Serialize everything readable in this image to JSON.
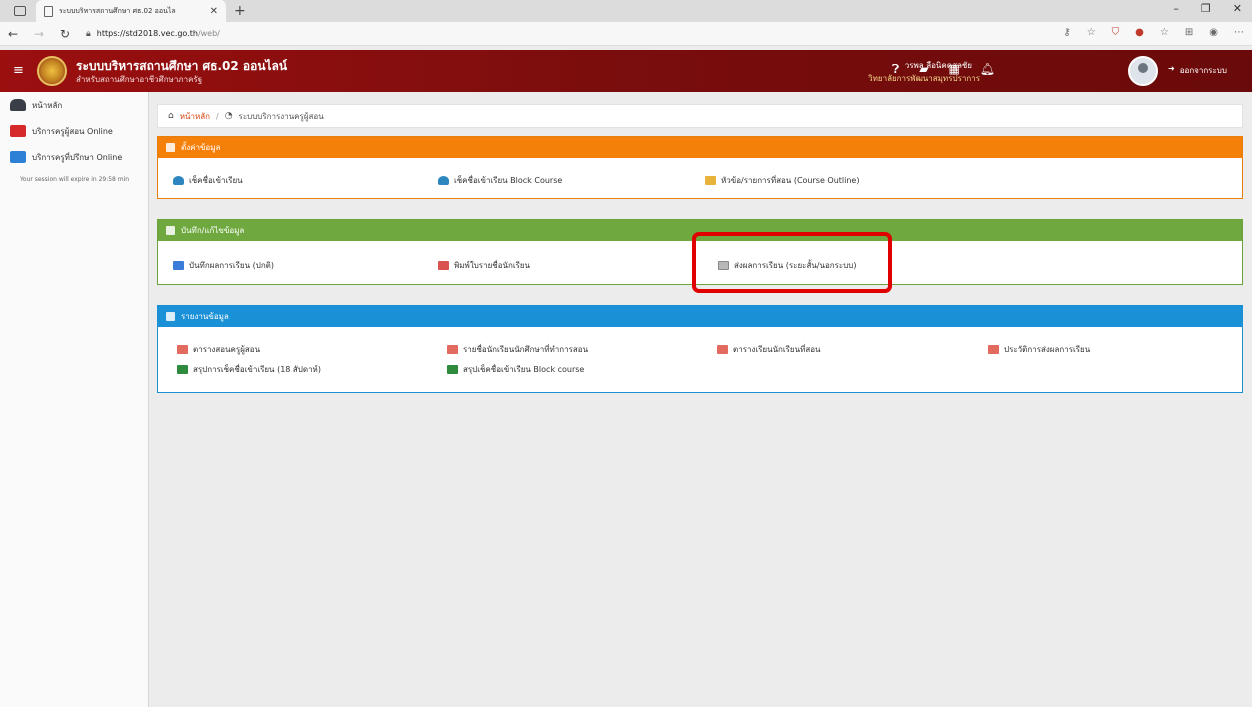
{
  "browser": {
    "tab_title": "ระบบบริหารสถานศึกษา ศธ.02 ออนไล",
    "url_host": "https://std2018.vec.go.th",
    "url_path": "/web/"
  },
  "header": {
    "title": "ระบบบริหารสถานศึกษา ศธ.02 ออนไลน์",
    "subtitle": "สำหรับสถานศึกษาอาชีวศึกษาภาครัฐ",
    "user_name": "วรพล ลือนิคคสุลชัย",
    "user_org": "วิทยาลัยการพัฒนาสมุทรปราการ",
    "logout_label": "ออกจากระบบ"
  },
  "sidebar": {
    "items": [
      {
        "label": "หน้าหลัก"
      },
      {
        "label": "บริการครูผู้สอน Online"
      },
      {
        "label": "บริการครูที่ปรึกษา Online"
      }
    ],
    "session_note": "Your session will expire in 29:58 min"
  },
  "breadcrumb": {
    "home": "หน้าหลัก",
    "separator": "/",
    "current": "ระบบบริการงานครูผู้สอน"
  },
  "panels": {
    "settings": {
      "title": "ตั้งค่าข้อมูล",
      "items": [
        "เช็คชื่อเข้าเรียน",
        "เช็คชื่อเข้าเรียน Block Course",
        "หัวข้อ/รายการที่สอน (Course Outline)"
      ]
    },
    "records": {
      "title": "บันทึก/แก้ไขข้อมูล",
      "items": [
        "บันทึกผลการเรียน (ปกติ)",
        "พิมพ์ใบรายชื่อนักเรียน",
        "ส่งผลการเรียน (ระยะสั้น/นอกระบบ)"
      ]
    },
    "reports": {
      "title": "รายงานข้อมูล",
      "items": [
        "ตารางสอนครูผู้สอน",
        "รายชื่อนักเรียนนักศึกษาที่ทำการสอน",
        "ตารางเรียนนักเรียนที่สอน",
        "ประวัติการส่งผลการเรียน",
        "สรุปการเช็คชื่อเข้าเรียน (18 สัปดาห์)",
        "สรุปเช็คชื่อเข้าเรียน Block course"
      ]
    }
  },
  "colors": {
    "header_bg": "#8b0f0f",
    "settings_accent": "#f4800a",
    "records_accent": "#6fa83f",
    "reports_accent": "#1a90d6",
    "highlight": "#e00000"
  }
}
